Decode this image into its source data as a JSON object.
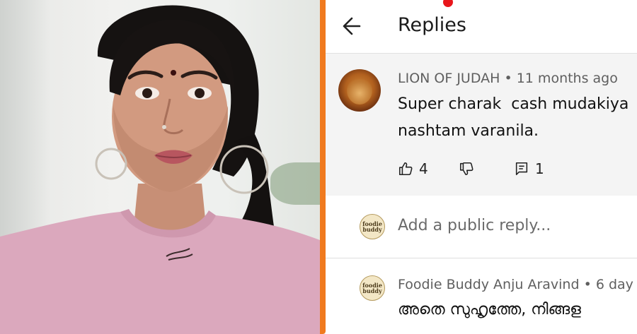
{
  "header": {
    "title": "Replies"
  },
  "comment": {
    "author": "LION OF JUDAH",
    "time": "11 months ago",
    "text_lines": [
      "Super charak  cash mudakiya",
      "nashtam varanila."
    ],
    "likes": "4",
    "replies": "1"
  },
  "reply_box": {
    "placeholder": "Add a public reply..."
  },
  "reply": {
    "author": "Foodie Buddy Anju Aravind",
    "time": "6 day",
    "text": "അതെ സുഹൃത്തേ, നിങ്ങള"
  },
  "avatar_text": {
    "line1": "foodie",
    "line2": "buddy"
  },
  "icons": [
    "back-arrow-icon",
    "thumbs-up-icon",
    "thumbs-down-icon",
    "reply-comment-icon"
  ],
  "colors": {
    "frame_orange": "#f07a1e",
    "dot_red": "#e8161b",
    "top_pink": "#d9a2b6"
  }
}
